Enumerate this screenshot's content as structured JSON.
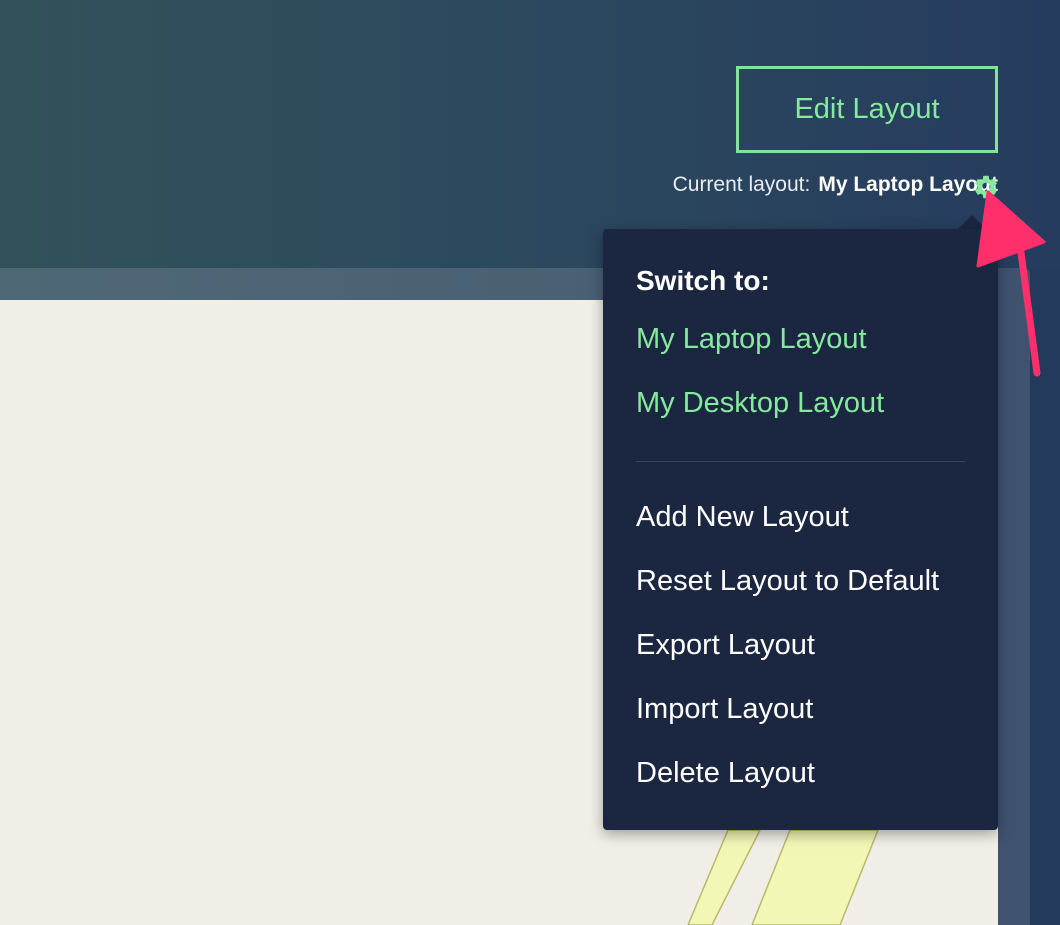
{
  "header": {
    "edit_button_label": "Edit Layout",
    "current_layout_prefix": "Current layout:",
    "current_layout_name": "My Laptop Layout"
  },
  "dropdown": {
    "heading": "Switch to:",
    "layouts": [
      {
        "label": "My Laptop Layout"
      },
      {
        "label": "My Desktop Layout"
      }
    ],
    "actions": [
      {
        "label": "Add New Layout"
      },
      {
        "label": "Reset Layout to Default"
      },
      {
        "label": "Export Layout"
      },
      {
        "label": "Import Layout"
      },
      {
        "label": "Delete Layout"
      }
    ]
  },
  "icons": {
    "settings": "gear-icon",
    "annotation": "pointer-arrow-icon"
  },
  "colors": {
    "accent_green": "#86ea9e",
    "dropdown_bg": "#1b2640",
    "arrow_pink": "#ff2f6c",
    "canvas_bg": "#f1eee7"
  }
}
